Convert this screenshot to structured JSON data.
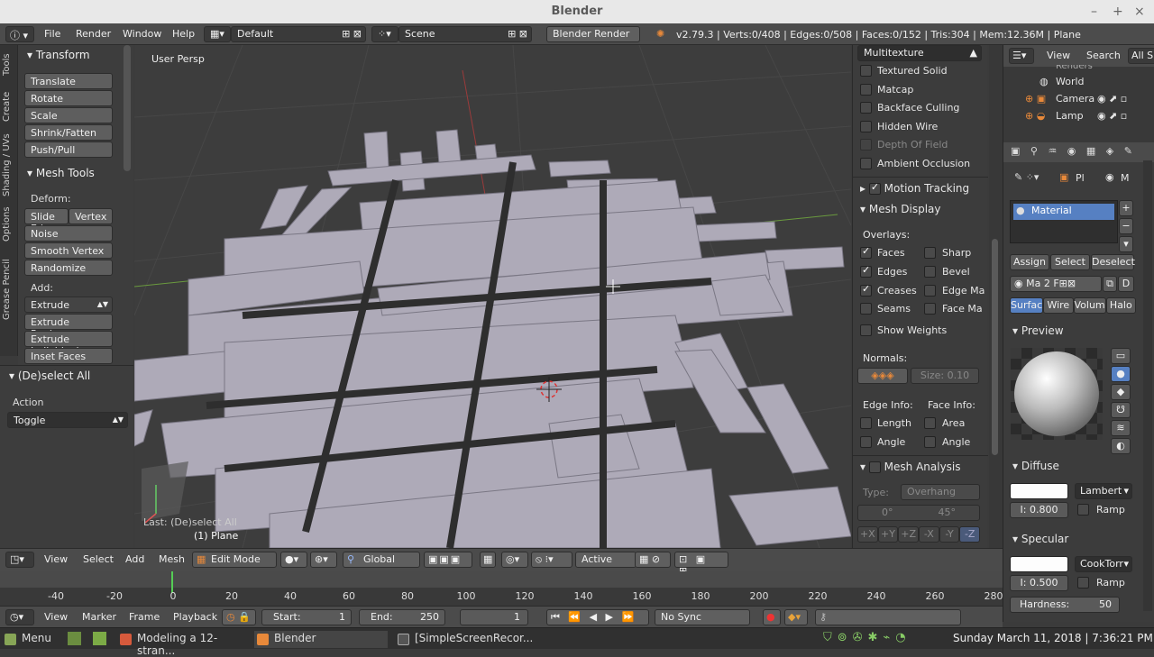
{
  "window": {
    "title": "Blender"
  },
  "info": {
    "menus": [
      "File",
      "Render",
      "Window",
      "Help"
    ],
    "layout": "Default",
    "scene": "Scene",
    "engine": "Blender Render",
    "stats": "v2.79.3 | Verts:0/408 | Edges:0/508 | Faces:0/152 | Tris:304 | Mem:12.36M | Plane"
  },
  "tabs": [
    "Tools",
    "Create",
    "Shading / UVs",
    "Options",
    "Grease Pencil"
  ],
  "toolshelf": {
    "transform_title": "Transform",
    "transform": [
      "Translate",
      "Rotate",
      "Scale",
      "Shrink/Fatten",
      "Push/Pull"
    ],
    "meshtools_title": "Mesh Tools",
    "deform_label": "Deform:",
    "slide_edge": "Slide Ed",
    "vertex": "Vertex",
    "noise": "Noise",
    "smooth_vertex": "Smooth Vertex",
    "randomize": "Randomize",
    "add_label": "Add:",
    "extrude": "Extrude",
    "extrude_region": "Extrude Region",
    "extrude_individual": "Extrude Individual",
    "inset_faces": "Inset Faces",
    "operator_title": "(De)select All",
    "action_label": "Action",
    "action_value": "Toggle"
  },
  "viewport": {
    "view_name": "User Persp",
    "last_op": "Last: (De)select All",
    "object": "(1) Plane"
  },
  "npanel": {
    "shading": "Multitexture",
    "options": [
      {
        "label": "Textured Solid",
        "checked": false
      },
      {
        "label": "Matcap",
        "checked": false
      },
      {
        "label": "Backface Culling",
        "checked": false
      },
      {
        "label": "Hidden Wire",
        "checked": false
      },
      {
        "label": "Depth Of Field",
        "checked": false
      },
      {
        "label": "Ambient Occlusion",
        "checked": false
      }
    ],
    "motion_tracking": "Motion Tracking",
    "mesh_display": "Mesh Display",
    "overlays_label": "Overlays:",
    "faces": "Faces",
    "edges": "Edges",
    "creases": "Creases",
    "seams": "Seams",
    "sharp": "Sharp",
    "bevel": "Bevel",
    "edge_marks": "Edge Ma",
    "face_marks": "Face Ma",
    "show_weights": "Show Weights",
    "normals_label": "Normals:",
    "size_label": "Size:",
    "size_value": "0.10",
    "edge_info": "Edge Info:",
    "face_info": "Face Info:",
    "length": "Length",
    "area": "Area",
    "angle_e": "Angle",
    "angle_f": "Angle",
    "mesh_analysis": "Mesh Analysis",
    "type_label": "Type:",
    "type_value": "Overhang",
    "min": "0°",
    "max": "45°",
    "axes": [
      "+X",
      "+Y",
      "+Z",
      "-X",
      "-Y",
      "-Z"
    ]
  },
  "outliner": {
    "menus": [
      "View",
      "Search",
      "All S"
    ],
    "items": [
      "Renders",
      "World",
      "Camera",
      "Lamp"
    ]
  },
  "properties": {
    "context": [
      "Pl",
      "M"
    ],
    "material_slot": "Material",
    "assign": "Assign",
    "select": "Select",
    "deselect": "Deselect",
    "mat_name": "Ma",
    "users": "2",
    "f": "F",
    "d": "D",
    "tabs": [
      "Surfac",
      "Wire",
      "Volum",
      "Halo"
    ],
    "preview": "Preview",
    "diffuse": "Diffuse",
    "diffuse_shader": "Lambert",
    "diffuse_intensity": "I: 0.800",
    "ramp": "Ramp",
    "specular": "Specular",
    "specular_shader": "CookTorr",
    "specular_intensity": "I: 0.500",
    "hardness_label": "Hardness:",
    "hardness": "50"
  },
  "vheader": {
    "menus": [
      "View",
      "Select",
      "Add",
      "Mesh"
    ],
    "mode": "Edit Mode",
    "orientation": "Global",
    "pivot": "Active"
  },
  "timeline": {
    "ticks": [
      "-40",
      "-20",
      "0",
      "20",
      "40",
      "60",
      "80",
      "100",
      "120",
      "140",
      "160",
      "180",
      "200",
      "220",
      "240",
      "260",
      "280"
    ],
    "menus": [
      "View",
      "Marker",
      "Frame",
      "Playback"
    ],
    "start_label": "Start:",
    "start": "1",
    "end_label": "End:",
    "end": "250",
    "current": "1",
    "sync": "No Sync"
  },
  "taskbar": {
    "menu": "Menu",
    "tasks": [
      "Modeling a 12-stran...",
      "Blender",
      "[SimpleScreenRecor..."
    ],
    "datetime": "Sunday March 11, 2018 | 7:36:21 PM"
  }
}
